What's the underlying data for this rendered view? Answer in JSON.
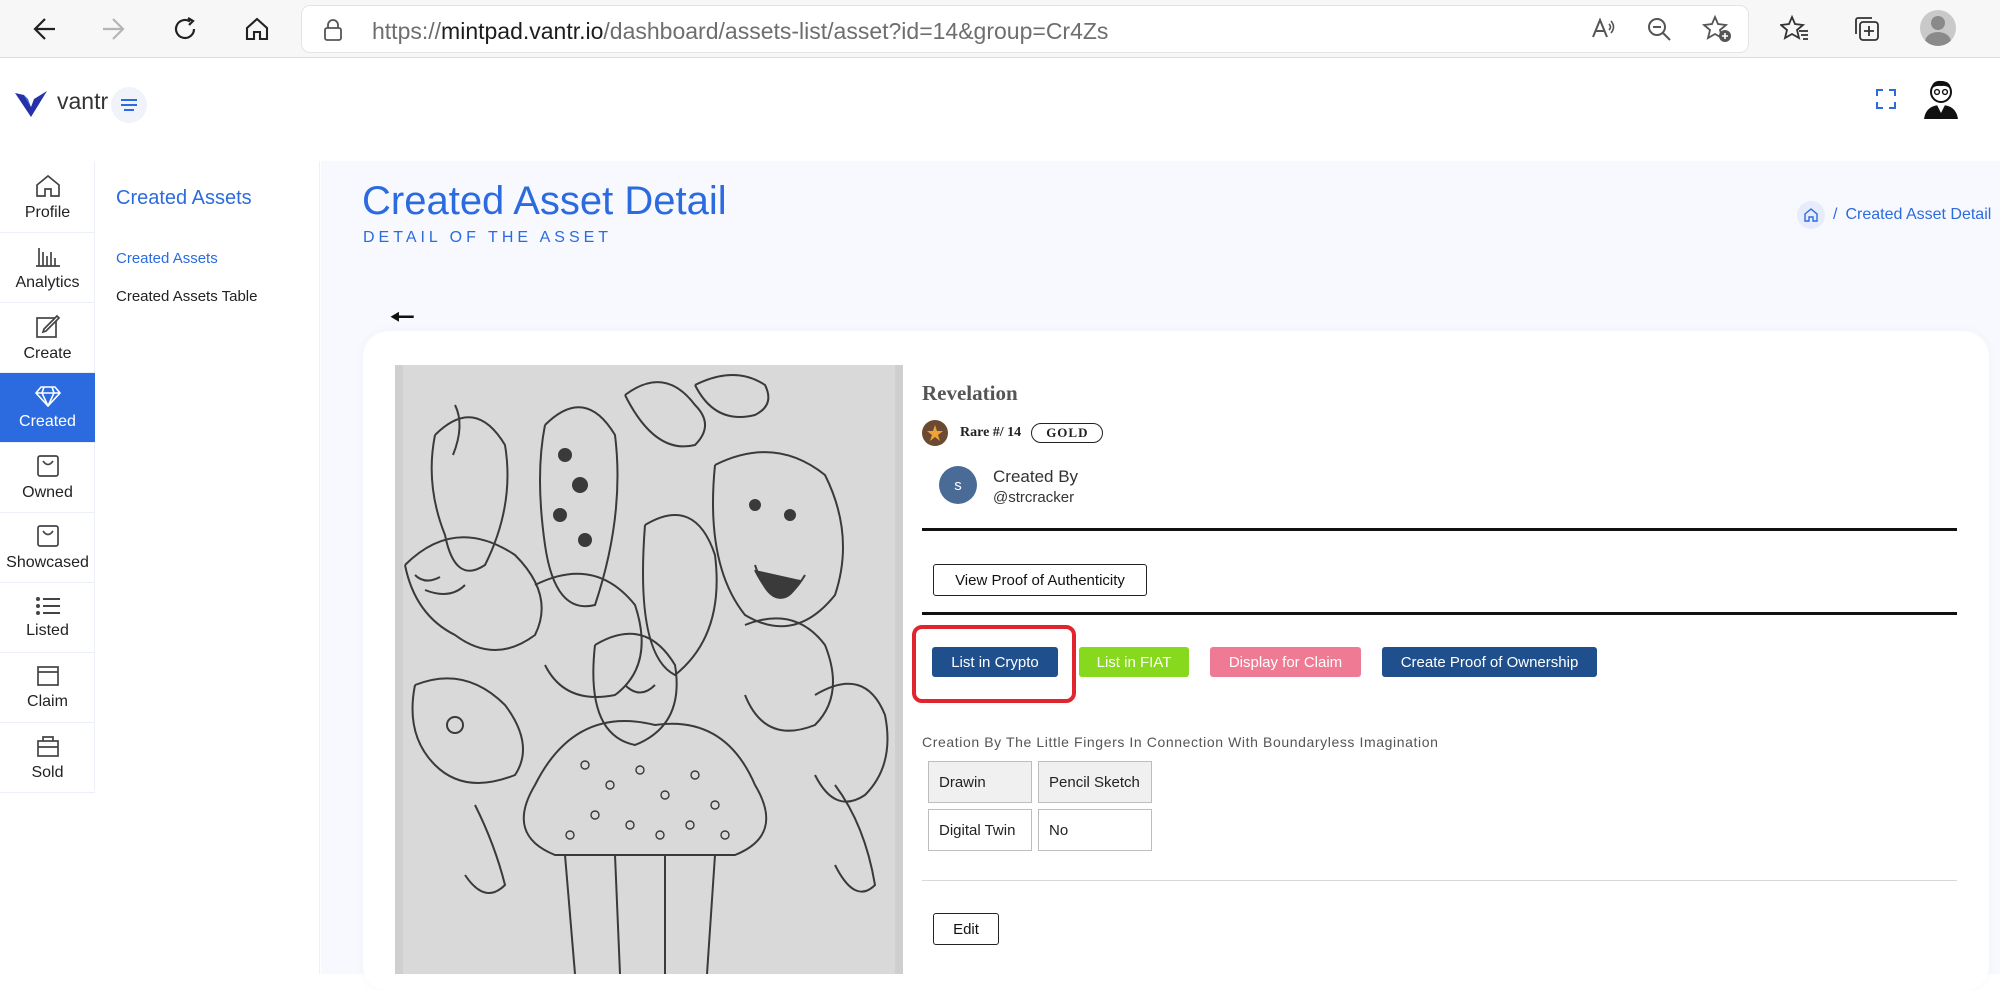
{
  "browser": {
    "url_prefix": "https://",
    "url_host": "mintpad.vantr.io",
    "url_path": "/dashboard/assets-list/asset?id=14&group=Cr4Zs"
  },
  "app": {
    "logo_text": "vantr"
  },
  "rail": {
    "items": [
      {
        "label": "Profile",
        "icon": "home-icon"
      },
      {
        "label": "Analytics",
        "icon": "bar-chart-icon"
      },
      {
        "label": "Create",
        "icon": "edit-icon"
      },
      {
        "label": "Created",
        "icon": "diamond-icon"
      },
      {
        "label": "Owned",
        "icon": "bag-icon"
      },
      {
        "label": "Showcased",
        "icon": "bag-icon"
      },
      {
        "label": "Listed",
        "icon": "list-icon"
      },
      {
        "label": "Claim",
        "icon": "window-icon"
      },
      {
        "label": "Sold",
        "icon": "store-icon"
      }
    ],
    "active": "Created"
  },
  "submenu": {
    "title": "Created Assets",
    "links": [
      "Created Assets",
      "Created Assets Table"
    ]
  },
  "page": {
    "title": "Created Asset Detail",
    "subtitle": "DETAIL OF THE ASSET",
    "breadcrumb_sep": "/",
    "breadcrumb_current": "Created Asset Detail",
    "back_arrow": "🠔"
  },
  "asset": {
    "name": "Revelation",
    "rare_text": "Rare #/ 14",
    "tier": "GOLD",
    "creator_initial": "s",
    "creator_label": "Created By",
    "creator_handle": "@strcracker",
    "description": "Creation By The Little Fingers In Connection With Boundaryless Imagination",
    "properties": [
      {
        "key": "Drawin",
        "value": "Pencil Sketch"
      },
      {
        "key": "Digital Twin",
        "value": "No"
      }
    ]
  },
  "actions": {
    "view_proof": "View Proof of Authenticity",
    "list_crypto": "List in Crypto",
    "list_fiat": "List in FIAT",
    "display_claim": "Display for Claim",
    "create_proof": "Create Proof of Ownership",
    "edit": "Edit"
  },
  "colors": {
    "accent": "#2c6bdf",
    "crypto_btn": "#1f4f8c",
    "fiat_btn": "#86d91c",
    "claim_btn": "#ef7a93",
    "proof_btn": "#1f4f8c",
    "highlight": "#e0252f"
  }
}
